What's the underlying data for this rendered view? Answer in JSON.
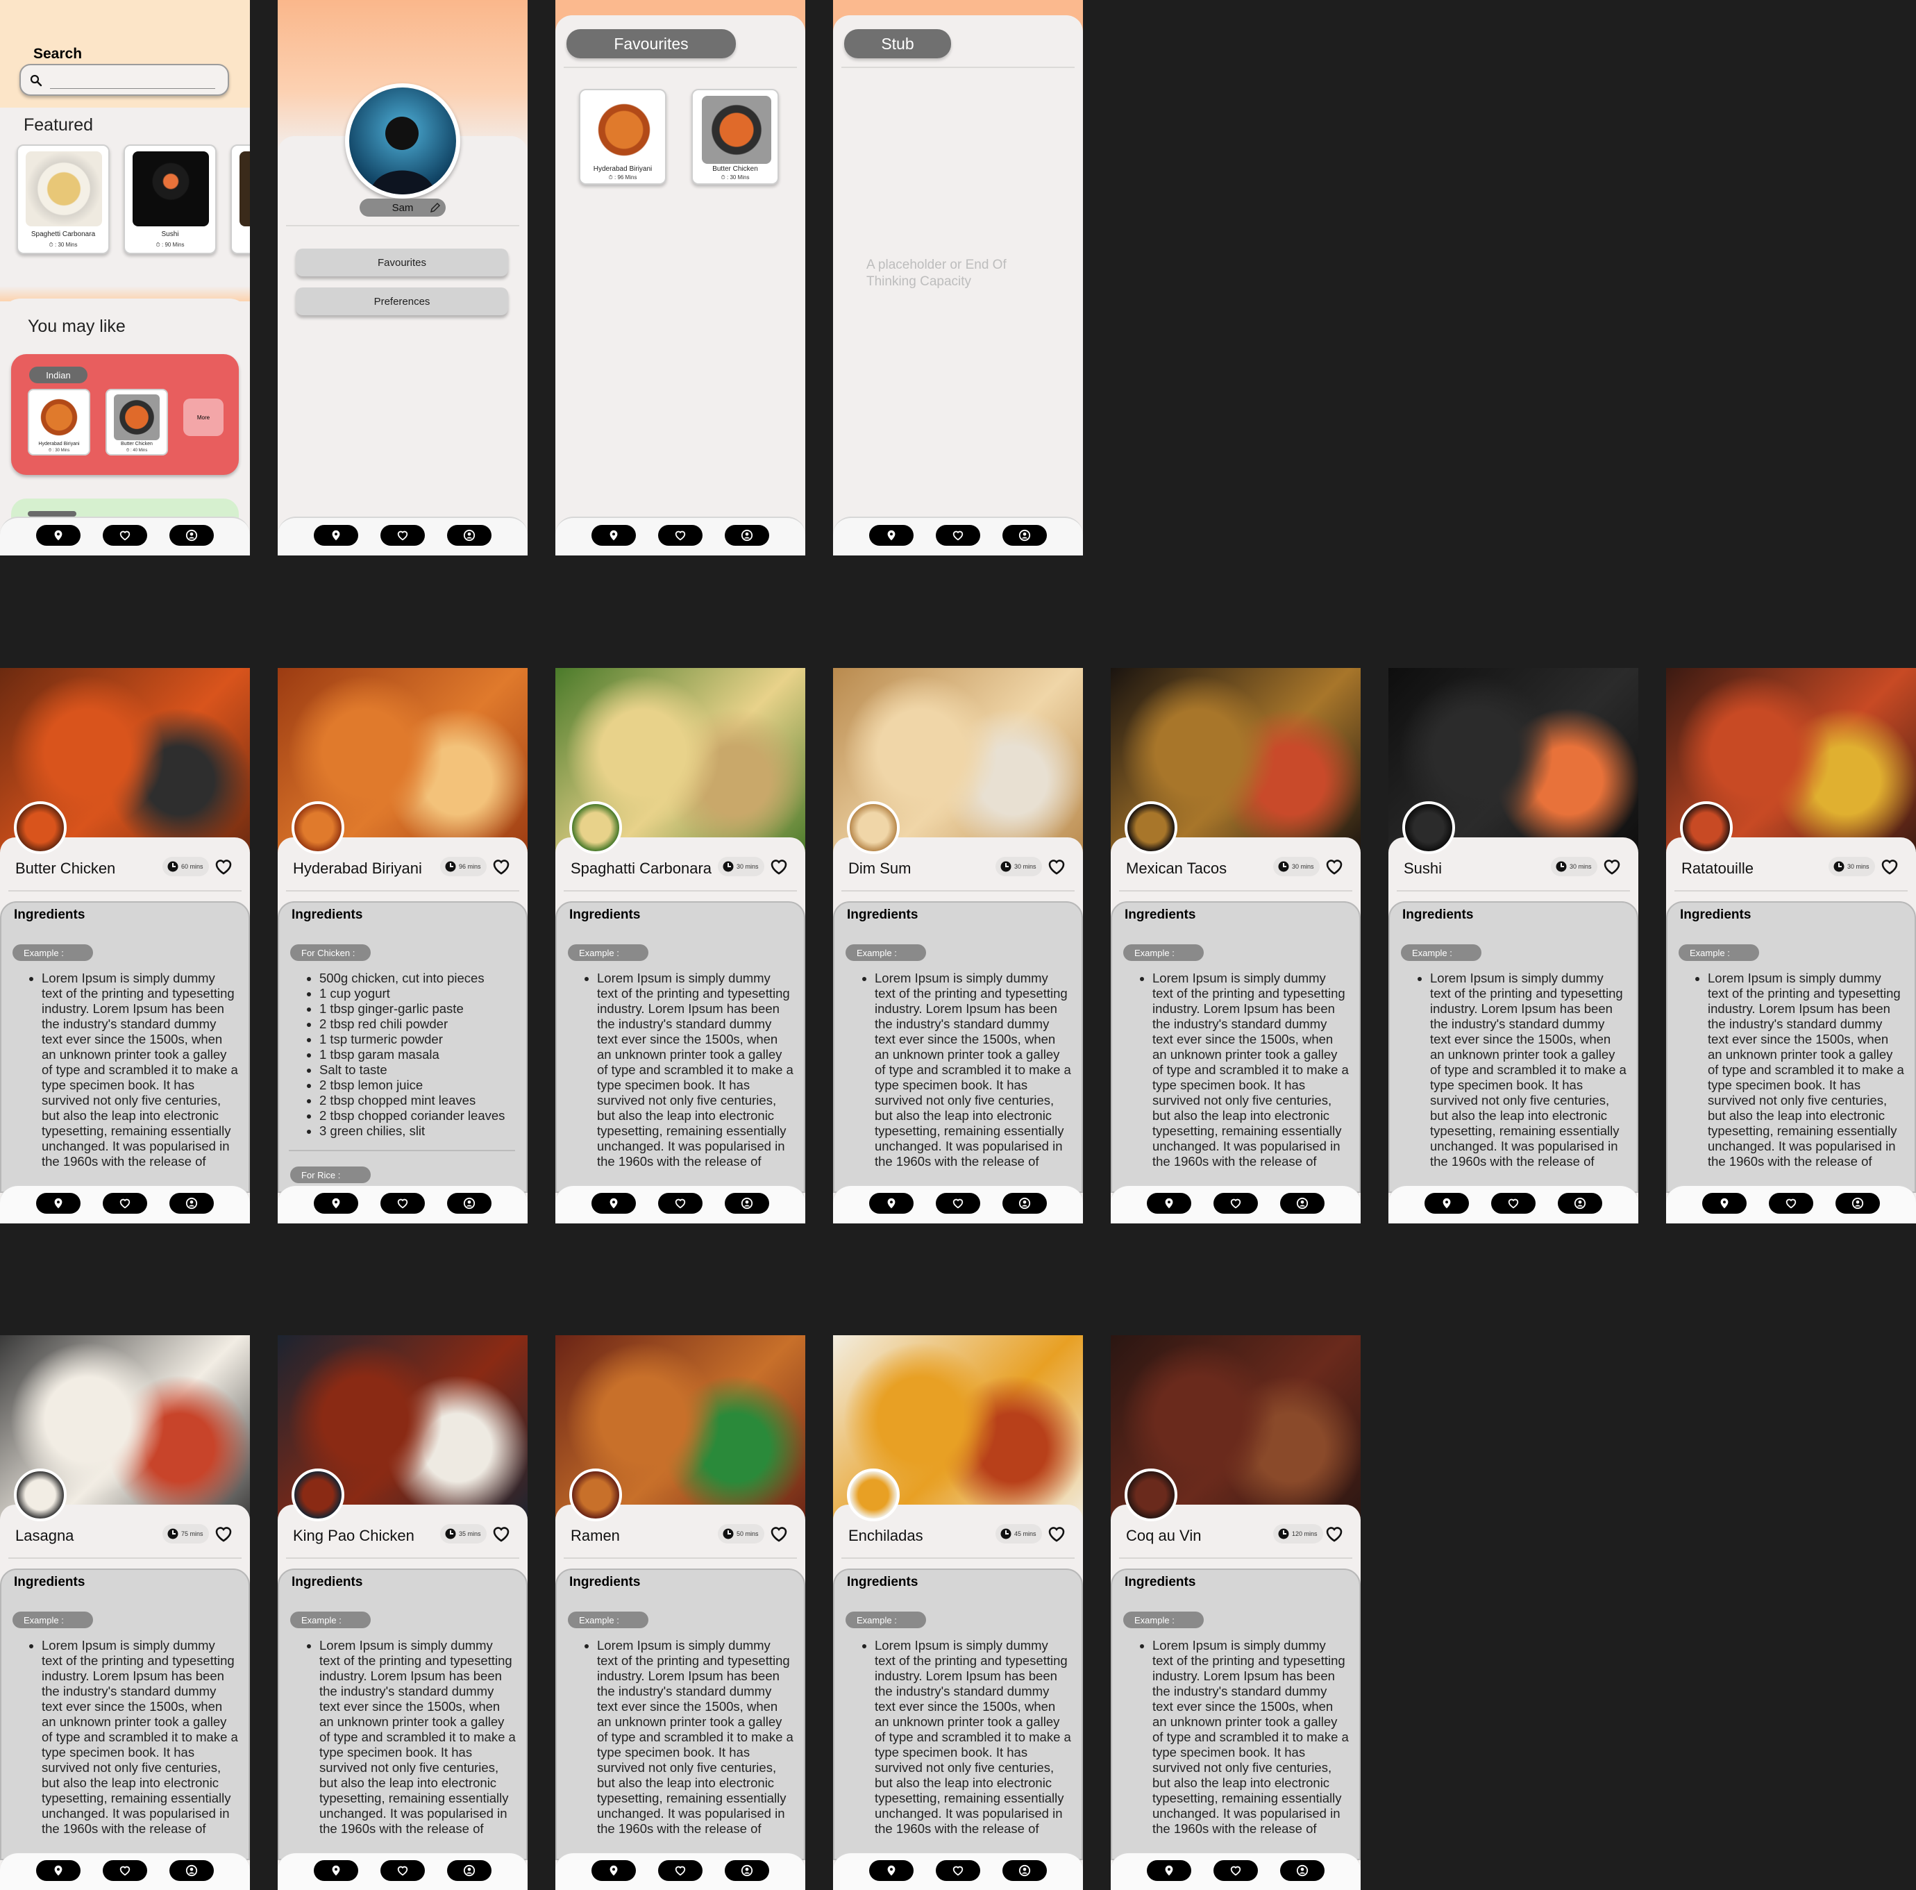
{
  "home": {
    "search_label": "Search",
    "search_placeholder": "",
    "featured_label": "Featured",
    "featured": [
      {
        "name": "Spaghetti Carbonara",
        "time": "⏱ : 30 Mins"
      },
      {
        "name": "Sushi",
        "time": "⏱ : 90 Mins"
      }
    ],
    "you_may_like_label": "You may like",
    "category": {
      "tag": "Indian",
      "items": [
        {
          "name": "Hyderabad Biriyani",
          "time": "⏱ : 30 Mins"
        },
        {
          "name": "Butter Chicken",
          "time": "⏱ : 40 Mins"
        }
      ],
      "more_label": "More"
    }
  },
  "profile": {
    "name": "Sam",
    "buttons": [
      "Favourites",
      "Preferences"
    ]
  },
  "favourites": {
    "title": "Favourites",
    "items": [
      {
        "name": "Hyderabad Biriyani",
        "time": "⏱ : 96 Mins"
      },
      {
        "name": "Butter Chicken",
        "time": "⏱ : 30 Mins"
      }
    ]
  },
  "stub": {
    "title": "Stub",
    "placeholder_text": "A placeholder or End Of Thinking Capacity"
  },
  "navbar": {
    "icons": [
      "location-icon",
      "heart-icon",
      "profile-icon"
    ],
    "color": "#000000"
  },
  "detail_common": {
    "ingredients_label": "Ingredients",
    "example_label": "Example :",
    "lorem": "Lorem Ipsum is simply dummy text of the printing and typesetting industry. Lorem Ipsum has been the industry's standard dummy text ever since the 1500s, when an unknown printer took a galley of type and scrambled it to make a type specimen book. It has survived not only five centuries, but also the leap into electronic typesetting, remaining essentially unchanged. It was popularised in the 1960s with the release of"
  },
  "biriyani_detail": {
    "section_label": "For Chicken :",
    "ingredients": [
      "500g chicken, cut into pieces",
      "1 cup yogurt",
      "1 tbsp ginger-garlic paste",
      "2 tbsp red chili powder",
      "1 tsp turmeric powder",
      "1 tbsp garam masala",
      "Salt to taste",
      "2 tbsp lemon juice",
      "2 tbsp chopped mint leaves",
      "2 tbsp chopped coriander leaves",
      "3 green chilies, slit"
    ],
    "rice_label": "For Rice :"
  },
  "dishes": [
    {
      "name": "Butter Chicken",
      "time": "60 mins",
      "colors": [
        "#6b2a10",
        "#d9541c",
        "#2e2e2e"
      ]
    },
    {
      "name": "Hyderabad Biriyani",
      "time": "96 mins",
      "colors": [
        "#9b3b12",
        "#e07a2c",
        "#f3c27a"
      ]
    },
    {
      "name": "Spaghatti Carbonara",
      "time": "30 mins",
      "colors": [
        "#4a7a2a",
        "#e8d28a",
        "#c9a86a"
      ]
    },
    {
      "name": "Dim Sum",
      "time": "30 mins",
      "colors": [
        "#b98a4e",
        "#f0d6a8",
        "#e8e0d2"
      ]
    },
    {
      "name": "Mexican Tacos",
      "time": "30 mins",
      "colors": [
        "#1a1410",
        "#a8762a",
        "#c94a2a"
      ]
    },
    {
      "name": "Sushi",
      "time": "30 mins",
      "colors": [
        "#0e0e0e",
        "#2b2b2b",
        "#e8723a"
      ]
    },
    {
      "name": "Ratatouille",
      "time": "30 mins",
      "colors": [
        "#3a1a12",
        "#c84a24",
        "#e0b030"
      ]
    },
    {
      "name": "Lasagna",
      "time": "75 mins",
      "colors": [
        "#3a3a3a",
        "#f2ede4",
        "#c8442a"
      ]
    },
    {
      "name": "King Pao Chicken",
      "time": "35 mins",
      "colors": [
        "#1c2430",
        "#8a2a14",
        "#eeeae2"
      ]
    },
    {
      "name": "Ramen",
      "time": "50 mins",
      "colors": [
        "#6a2416",
        "#c8702a",
        "#2a8a3a"
      ]
    },
    {
      "name": "Enchiladas",
      "time": "45 mins",
      "colors": [
        "#f2ede0",
        "#e8a024",
        "#b8401a"
      ]
    },
    {
      "name": "Coq au Vin",
      "time": "120 mins",
      "colors": [
        "#2a1612",
        "#6a2a1c",
        "#8a4a2a"
      ]
    }
  ]
}
